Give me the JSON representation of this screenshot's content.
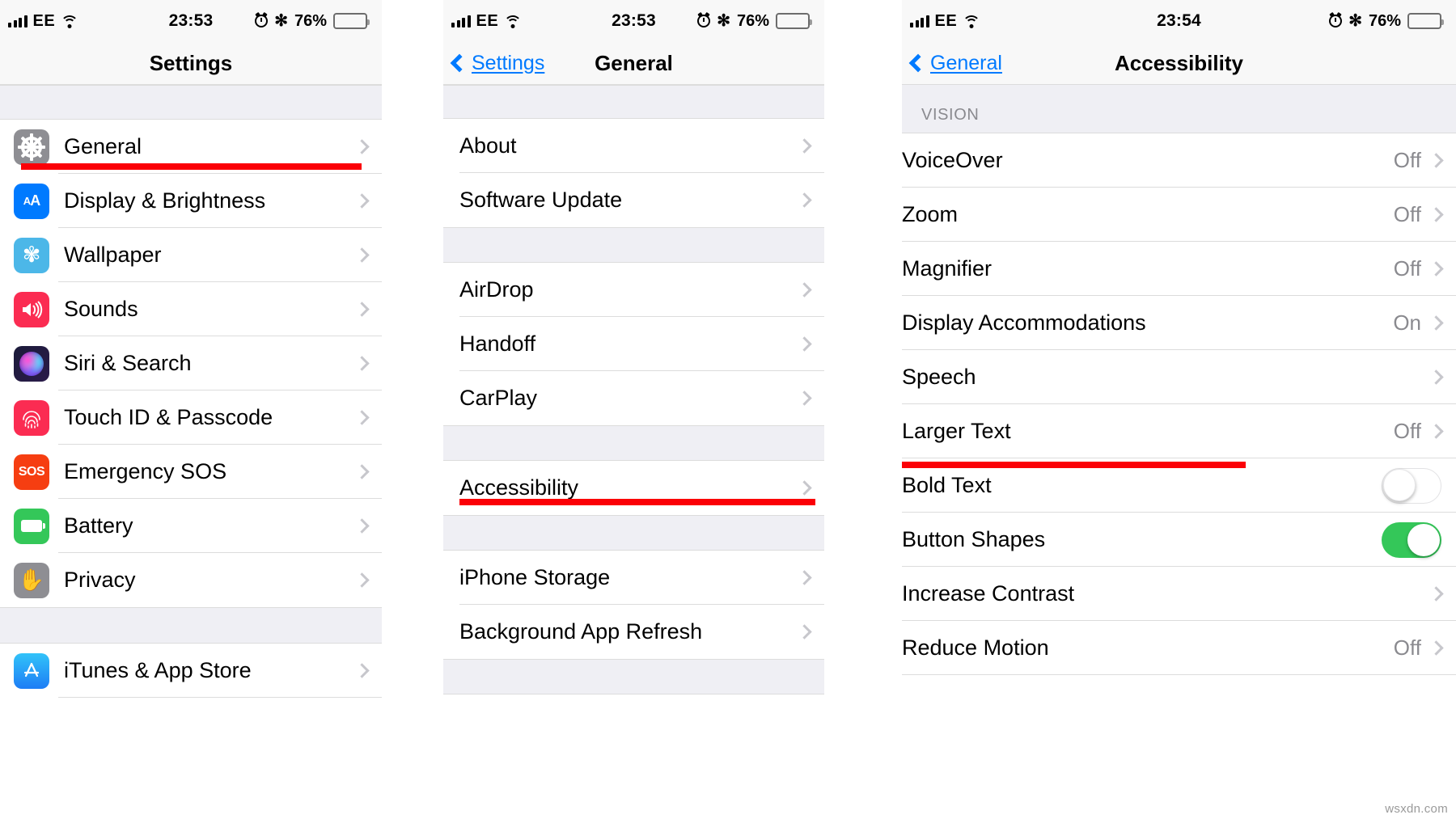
{
  "watermark": "wsxdn.com",
  "accent": {
    "link": "#007aff",
    "highlight": "#fb0007",
    "toggle_on": "#34c759",
    "value_gray": "#8a8a8f"
  },
  "panels": [
    {
      "id": "settings",
      "status": {
        "carrier": "EE",
        "time": "23:53",
        "battery_percent": "76%"
      },
      "nav": {
        "title": "Settings",
        "back_label": ""
      },
      "rows": [
        {
          "label": "General",
          "icon": "gear-icon",
          "highlighted": true
        },
        {
          "label": "Display & Brightness",
          "icon": "display-icon"
        },
        {
          "label": "Wallpaper",
          "icon": "wallpaper-icon"
        },
        {
          "label": "Sounds",
          "icon": "sounds-icon"
        },
        {
          "label": "Siri & Search",
          "icon": "siri-icon"
        },
        {
          "label": "Touch ID & Passcode",
          "icon": "touchid-icon"
        },
        {
          "label": "Emergency SOS",
          "icon": "sos-icon"
        },
        {
          "label": "Battery",
          "icon": "battery-icon"
        },
        {
          "label": "Privacy",
          "icon": "privacy-icon"
        },
        {
          "label": "iTunes & App Store",
          "icon": "appstore-icon"
        }
      ],
      "icon_glyphs": {
        "display": "A",
        "display_small": "A",
        "wallpaper": "✾",
        "sounds": "🔊",
        "touchid": "☍",
        "sos": "SOS",
        "privacy": "✋",
        "appstore": "A"
      }
    },
    {
      "id": "general",
      "status": {
        "carrier": "EE",
        "time": "23:53",
        "battery_percent": "76%"
      },
      "nav": {
        "title": "General",
        "back_label": "Settings"
      },
      "rows": [
        {
          "label": "About"
        },
        {
          "label": "Software Update"
        },
        {
          "label": "AirDrop"
        },
        {
          "label": "Handoff"
        },
        {
          "label": "CarPlay"
        },
        {
          "label": "Accessibility",
          "highlighted": true
        },
        {
          "label": "iPhone Storage"
        },
        {
          "label": "Background App Refresh"
        }
      ]
    },
    {
      "id": "accessibility",
      "status": {
        "carrier": "EE",
        "time": "23:54",
        "battery_percent": "76%"
      },
      "nav": {
        "title": "Accessibility",
        "back_label": "General"
      },
      "section_header": "VISION",
      "rows": [
        {
          "label": "VoiceOver",
          "value": "Off",
          "control": "chevron"
        },
        {
          "label": "Zoom",
          "value": "Off",
          "control": "chevron"
        },
        {
          "label": "Magnifier",
          "value": "Off",
          "control": "chevron"
        },
        {
          "label": "Display Accommodations",
          "value": "On",
          "control": "chevron"
        },
        {
          "label": "Speech",
          "value": "",
          "control": "chevron"
        },
        {
          "label": "Larger Text",
          "value": "Off",
          "control": "chevron",
          "highlighted": true
        },
        {
          "label": "Bold Text",
          "value": "",
          "control": "toggle-off"
        },
        {
          "label": "Button Shapes",
          "value": "",
          "control": "toggle-on"
        },
        {
          "label": "Increase Contrast",
          "value": "",
          "control": "chevron"
        },
        {
          "label": "Reduce Motion",
          "value": "Off",
          "control": "chevron"
        }
      ]
    }
  ]
}
